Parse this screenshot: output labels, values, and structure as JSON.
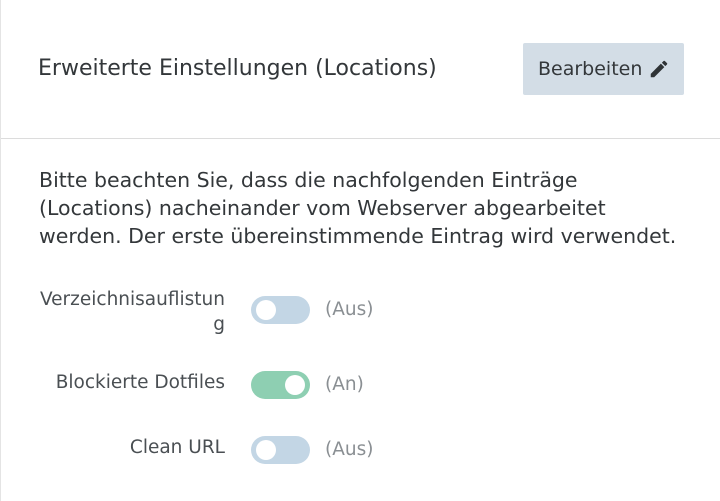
{
  "header": {
    "title": "Erweiterte Einstellungen (Locations)",
    "edit_label": "Bearbeiten",
    "edit_icon": "pencil-icon"
  },
  "description": "Bitte beachten Sie, dass die nachfolgenden Einträge (Locations) nacheinander vom Webserver abgearbeitet werden. Der erste übereinstimmende Eintrag wird verwendet.",
  "settings": [
    {
      "label": "Verzeichnisauflistung",
      "enabled": false,
      "state": "(Aus)"
    },
    {
      "label": "Blockierte Dotfiles",
      "enabled": true,
      "state": "(An)"
    },
    {
      "label": "Clean URL",
      "enabled": false,
      "state": "(Aus)"
    }
  ],
  "colors": {
    "toggle_off": "#c3d6e5",
    "toggle_on": "#8ecfb2",
    "button_bg": "#d3dde6"
  }
}
